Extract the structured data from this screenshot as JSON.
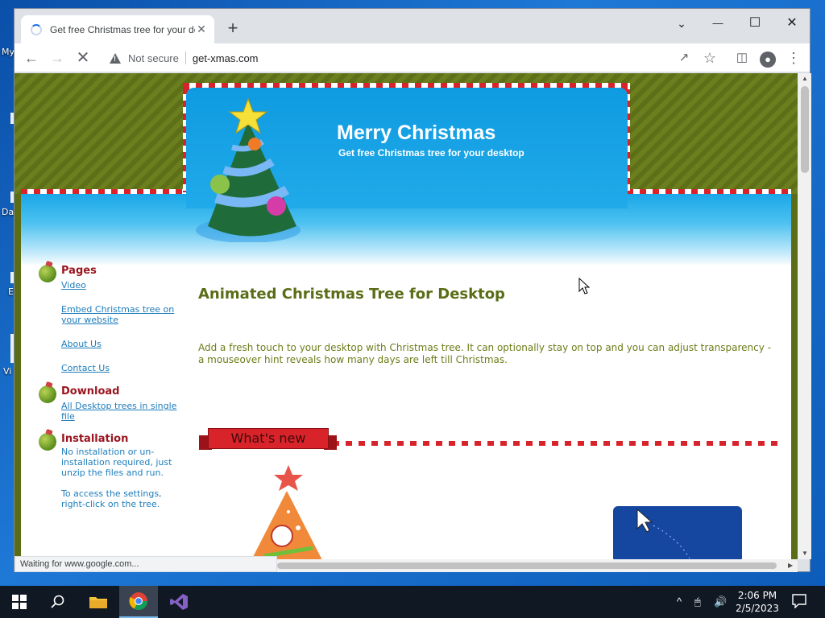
{
  "desktop": {
    "labels": [
      "My",
      "Da",
      "E",
      "Vi"
    ]
  },
  "browser": {
    "tab_title": "Get free Christmas tree for your desktop",
    "new_tab": "+",
    "window_controls": {
      "tabsearch": "⌄",
      "minimize": "—",
      "maximize": "☐",
      "close": "✕"
    },
    "security_label": "Not secure",
    "url": "get-xmas.com",
    "status_text": "Waiting for www.google.com..."
  },
  "site": {
    "title": "Merry Christmas",
    "subtitle": "Get free Christmas tree for your desktop",
    "sidebar": {
      "pages_heading": "Pages",
      "pages_links": [
        "Video",
        "Embed Christmas tree on your website",
        "About Us",
        "Contact Us"
      ],
      "download_heading": "Download",
      "download_link": "All Desktop trees in single file",
      "installation_heading": "Installation",
      "installation_text_1": "No installation or un-installation required, just unzip the files and run.",
      "installation_text_2": "To access the settings, right-click on the tree."
    },
    "main_heading": "Animated Christmas Tree for Desktop",
    "main_paragraph": "Add a fresh touch to your desktop with Christmas tree. It can optionally stay on top and you can adjust transparency - a mouseover hint reveals how many days are left till Christmas.",
    "whats_new": "What's new"
  },
  "taskbar": {
    "clock_time": "2:06 PM",
    "clock_date": "2/5/2023"
  }
}
